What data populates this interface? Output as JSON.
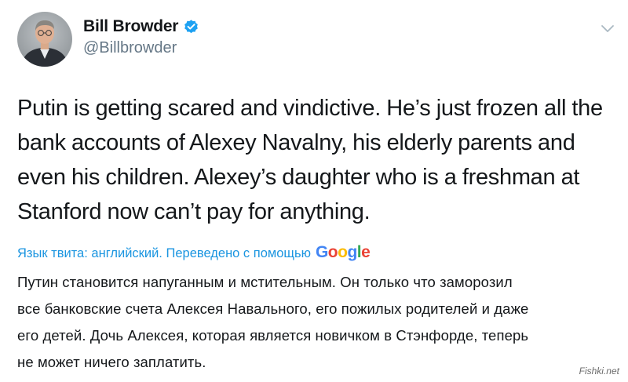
{
  "author": {
    "display_name": "Bill Browder",
    "handle": "@Billbrowder",
    "verified": true
  },
  "tweet": {
    "text": "Putin is getting scared and vindictive. He’s just frozen all the\nbank accounts of Alexey Navalny, his elderly parents and\neven his children. Alexey’s daughter who is a freshman at\nStanford now can’t pay for anything."
  },
  "translation": {
    "notice": "Язык твита: английский. Переведено с помощью",
    "provider": "Google",
    "text": "Путин становится напуганным и мстительным. Он только что заморозил\nвсе банковские счета Алексея Навального, его пожилых родителей и даже\nего детей. Дочь Алексея, которая является новичком в Стэнфорде, теперь\nне может ничего заплатить."
  },
  "watermark": "Fishki.net",
  "icons": {
    "avatar": "avatar",
    "verified": "verified-badge-icon",
    "menu": "chevron-down-icon"
  },
  "colors": {
    "link_blue": "#1b95e0",
    "verified_blue": "#1da1f2",
    "text": "#14171a",
    "secondary": "#657786"
  }
}
